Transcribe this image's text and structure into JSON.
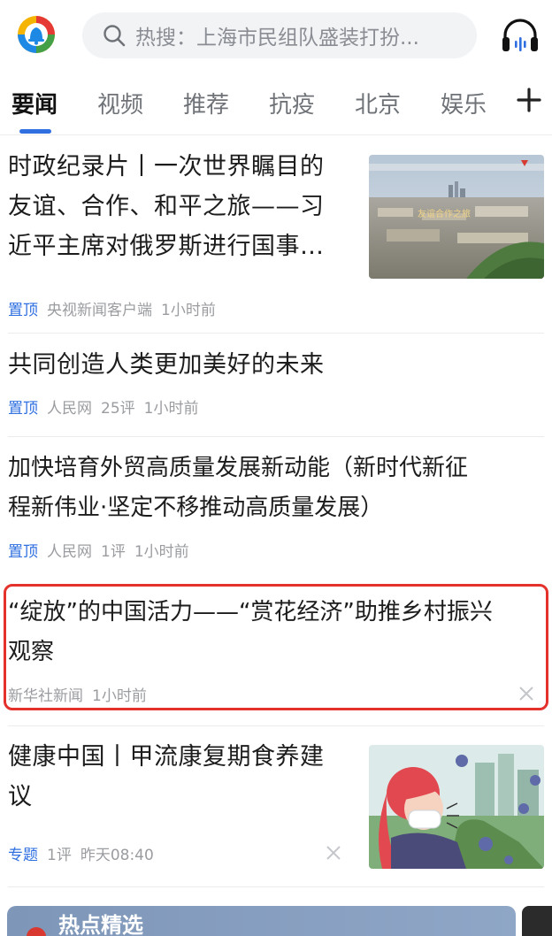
{
  "search": {
    "placeholder": "热搜：上海市民组队盛装打扮..."
  },
  "tabs": [
    {
      "label": "要闻"
    },
    {
      "label": "视频"
    },
    {
      "label": "推荐"
    },
    {
      "label": "抗疫"
    },
    {
      "label": "北京"
    },
    {
      "label": "娱乐"
    }
  ],
  "feed": [
    {
      "title_lines": [
        "时政纪录片丨一次世界瞩目的",
        "友谊、合作、和平之旅——习",
        "近平主席对俄罗斯进行国事…"
      ],
      "tag": "置顶",
      "source": "央视新闻客户端",
      "comments": "",
      "time": "1小时前",
      "thumb_caption": "友谊合作之旅"
    },
    {
      "title_lines": [
        "共同创造人类更加美好的未来"
      ],
      "tag": "置顶",
      "source": "人民网",
      "comments": "25评",
      "time": "1小时前"
    },
    {
      "title_lines": [
        "加快培育外贸高质量发展新动能（新时代新征",
        "程新伟业·坚定不移推动高质量发展）"
      ],
      "tag": "置顶",
      "source": "人民网",
      "comments": "1评",
      "time": "1小时前"
    },
    {
      "title_lines": [
        "“绽放”的中国活力——“赏花经济”助推乡村振兴",
        "观察"
      ],
      "tag": "",
      "source": "新华社新闻",
      "comments": "",
      "time": "1小时前"
    },
    {
      "title_lines": [
        "健康中国丨甲流康复期食养建",
        "议"
      ],
      "tag": "专题",
      "source": "",
      "comments": "1评",
      "time": "昨天08:40"
    }
  ],
  "bottom_card": {
    "title": "热点精选"
  },
  "colors": {
    "accent": "#2f6fe0",
    "highlight": "#e4312b"
  }
}
